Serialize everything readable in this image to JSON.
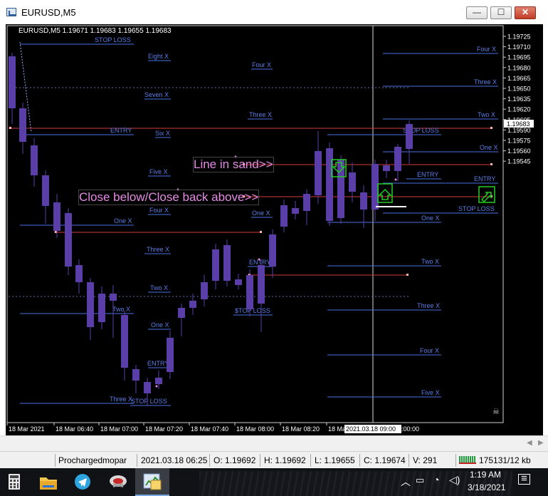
{
  "window": {
    "title": "EURUSD,M5",
    "minimize_label": "—",
    "maximize_label": "☐",
    "close_label": "✕"
  },
  "chart": {
    "info": "EURUSD,M5  1.19671 1.19683 1.19655 1.19683",
    "price_labels": [
      "1.19725",
      "1.19710",
      "1.19695",
      "1.19680",
      "1.19665",
      "1.19650",
      "1.19635",
      "1.19620",
      "1.19605",
      "1.19590",
      "1.19575",
      "1.19560",
      "1.19545"
    ],
    "current_price": "1.19683",
    "time_labels": [
      "18 Mar 2021",
      "18 Mar 06:40",
      "18 Mar 07:00",
      "18 Mar 07:20",
      "18 Mar 07:40",
      "18 Mar 08:00",
      "18 Mar 08:20",
      "18 Ma"
    ],
    "cursor_time": "2021.03.18 09:00",
    "cursor_time_tail": ":00:00",
    "annotation_line_in_sand": "Line in sand>>",
    "annotation_close": "Close below/Close back above>>",
    "level_labels": {
      "stop_loss": "STOP LOSS",
      "entry": "ENTRY",
      "one_x": "One X",
      "two_x": "Two X",
      "three_x": "Three X",
      "four_x": "Four X",
      "five_x": "Five X",
      "six_x": "Six X",
      "seven_x": "Seven X",
      "eight_x": "Eight X",
      "ssl_stop_loss": "$TOP LOSS"
    },
    "colors": {
      "background": "#000000",
      "bull_candle": "#9b72e6",
      "bear_candle": "#5a3fa8",
      "level_line": "#4a6fe3",
      "level_text": "#5b7ee8",
      "red_line": "#d23a3a",
      "arrow_box": "#22d022",
      "annotation_text": "#e58be5"
    }
  },
  "statusbar": {
    "profile": "Prochargedmopar",
    "datetime": "2021.03.18 06:25",
    "open": "O: 1.19692",
    "high": "H: 1.19692",
    "low": "L: 1.19655",
    "close": "C: 1.19674",
    "volume": "V: 291",
    "traffic": "175131/12 kb"
  },
  "taskbar": {
    "time": "1:19 AM",
    "date": "3/18/2021"
  }
}
